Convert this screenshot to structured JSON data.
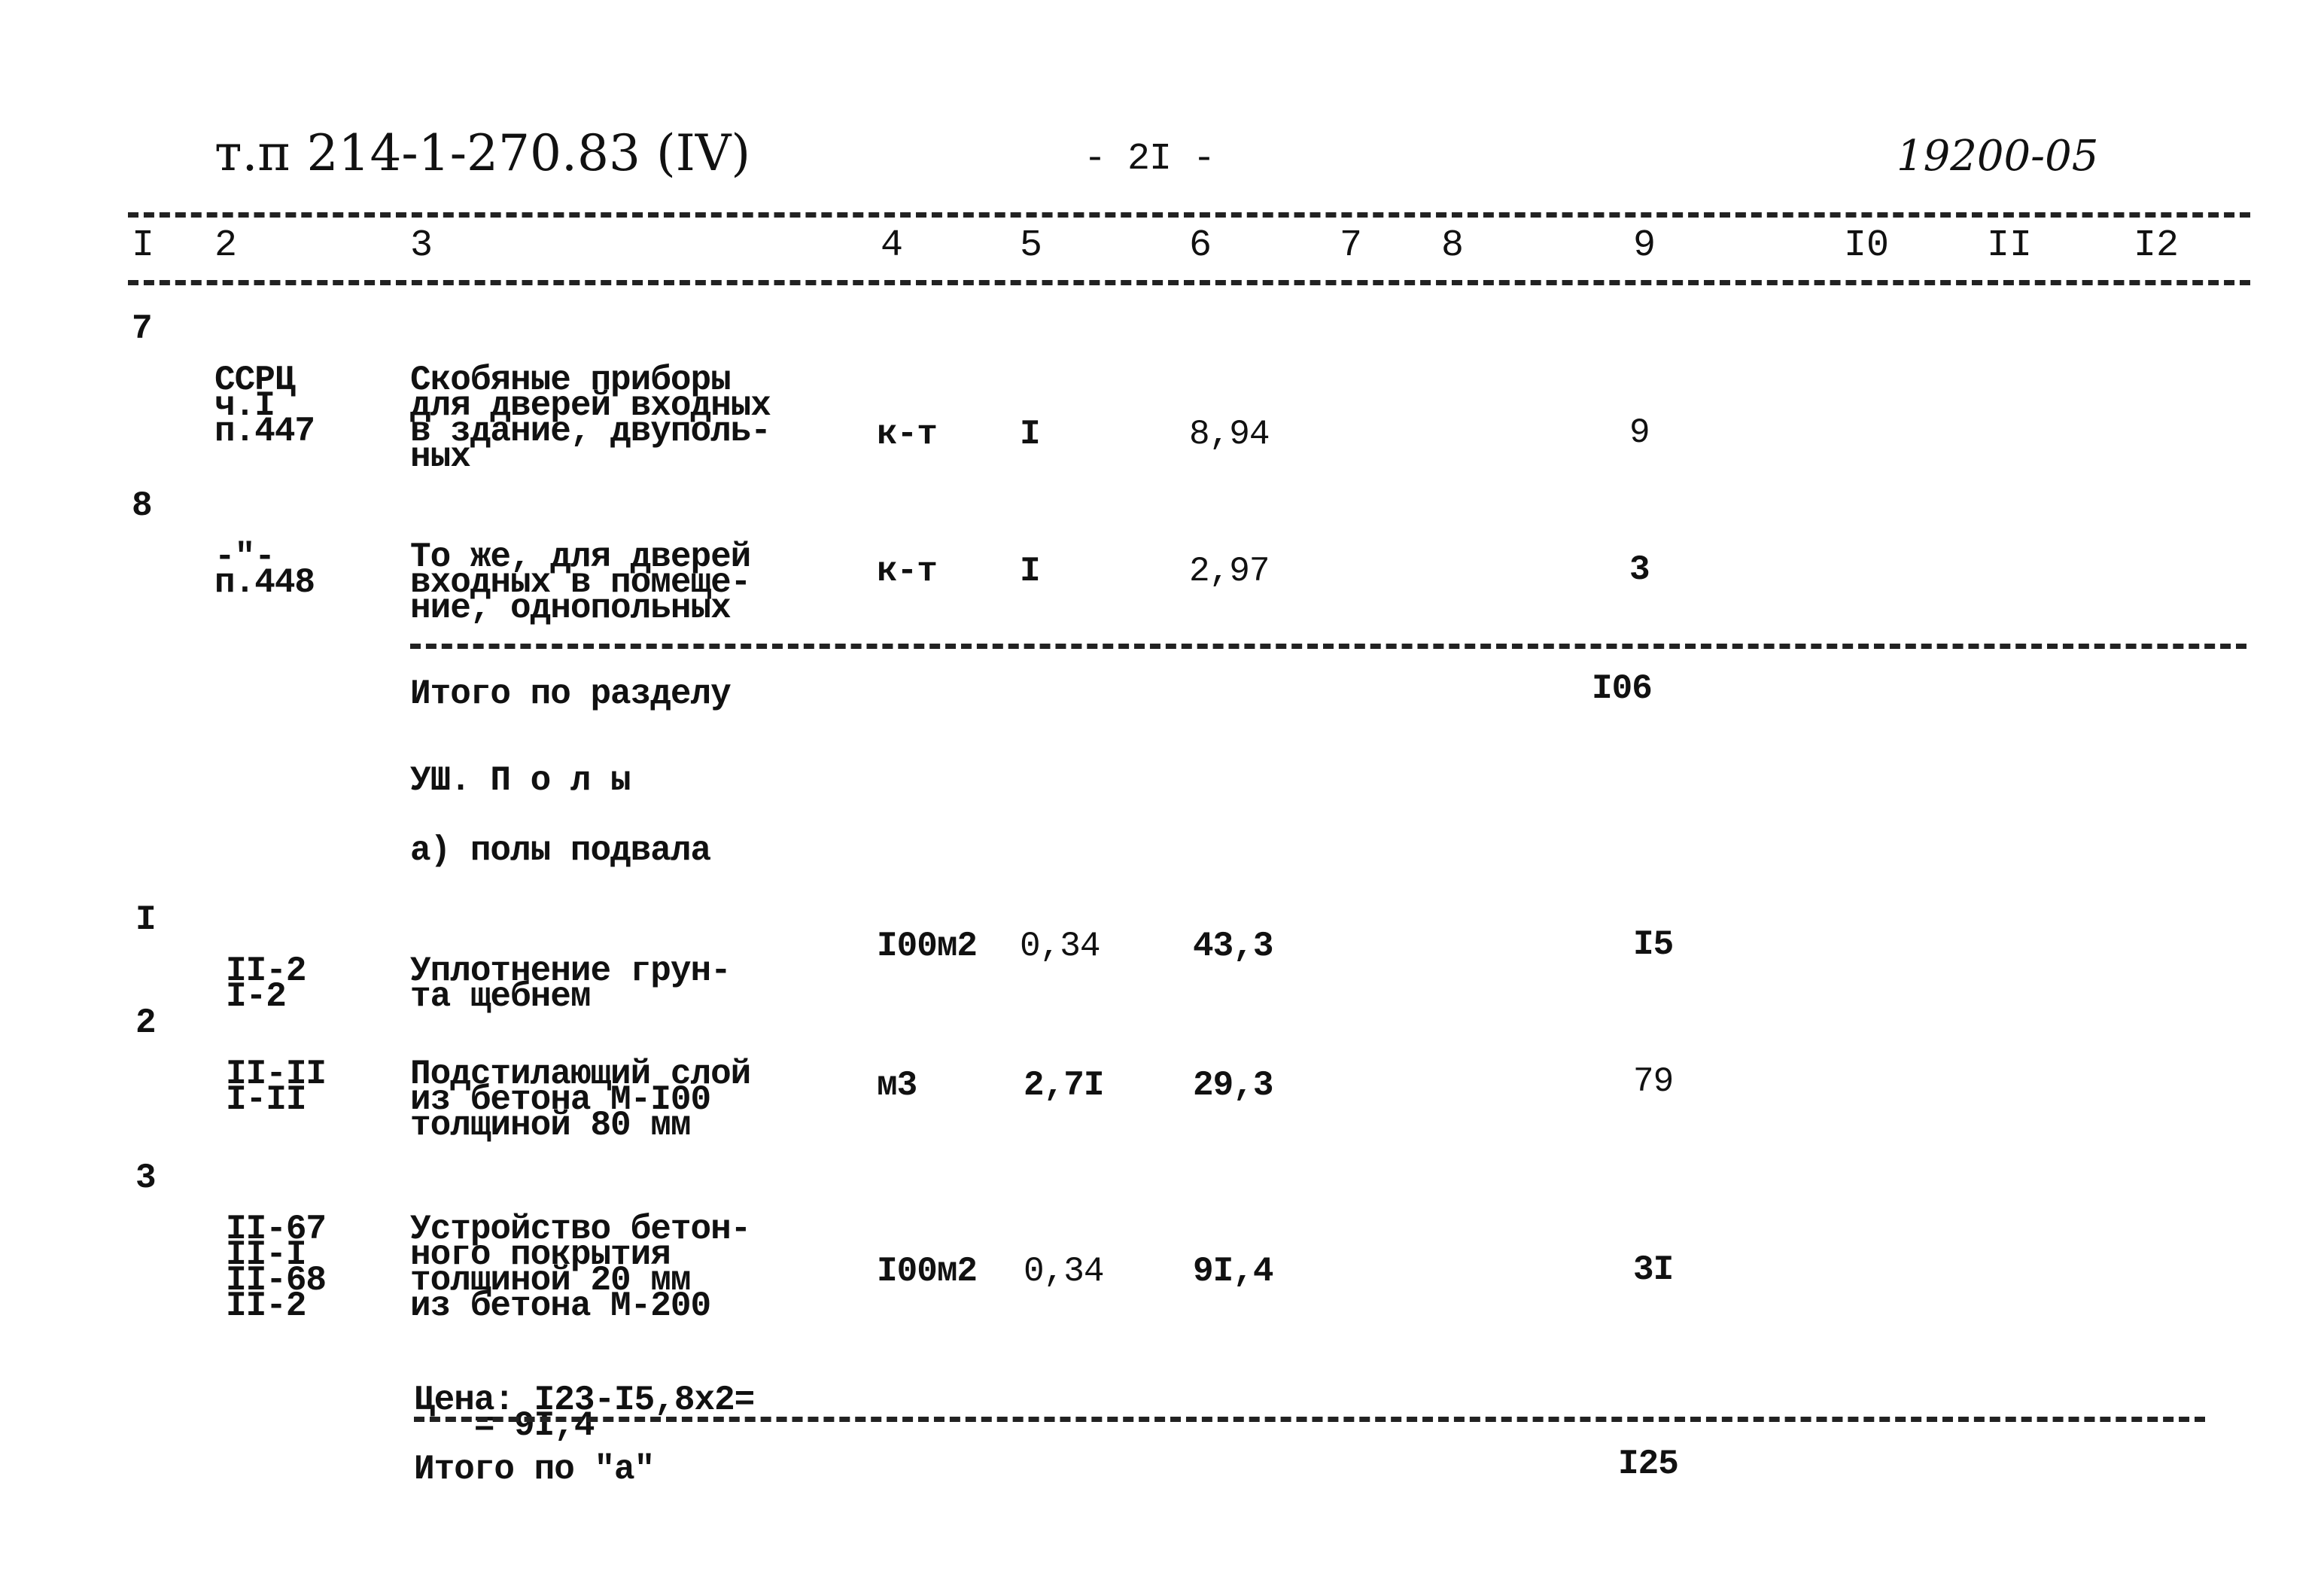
{
  "header": {
    "doc_code": "т.п 214-1-270.83 (IV)",
    "page_number": "- 2I -",
    "archive_number": "19200-05"
  },
  "columns": [
    "I",
    "2",
    "3",
    "4",
    "5",
    "6",
    "7",
    "8",
    "9",
    "I0",
    "II",
    "I2"
  ],
  "rows_part1": [
    {
      "num": "7",
      "code": [
        "ССРЦ",
        "ч.I",
        "п.447"
      ],
      "desc": [
        "Скобяные приборы",
        "для дверей входных",
        "в здание, двуполь-",
        "ных"
      ],
      "unit": "к-т",
      "qty": "I",
      "price": "8,94",
      "total": "9"
    },
    {
      "num": "8",
      "code": [
        "-\"-",
        "п.448"
      ],
      "desc": [
        "То же, для дверей",
        "входных в помеще-",
        "ние, однопольных"
      ],
      "unit": "к-т",
      "qty": "I",
      "price": "2,97",
      "total": "3"
    }
  ],
  "section_total": {
    "label": "Итого по разделу",
    "value": "I06"
  },
  "section_title": "УШ. П о л ы",
  "subsection_title": "а) полы подвала",
  "rows_part2": [
    {
      "num": "I",
      "code": [
        "II-2",
        "I-2"
      ],
      "desc": [
        "Уплотнение грун-",
        "та щебнем"
      ],
      "unit": "I00м2",
      "qty": "0,34",
      "price": "43,3",
      "total": "I5"
    },
    {
      "num": "2",
      "code": [
        "II-II",
        "I-II"
      ],
      "desc": [
        "Подстилающий слой",
        "из бетона М-I00",
        "толщиной 80 мм"
      ],
      "unit": "м3",
      "qty": "2,7I",
      "price": "29,3",
      "total": "79"
    },
    {
      "num": "3",
      "code": [
        "II-67",
        "II-I",
        "II-68",
        "II-2"
      ],
      "desc": [
        "Устройство бетон-",
        "ного покрытия",
        "толщиной 20 мм",
        "из бетона М-200"
      ],
      "unit": "I00м2",
      "qty": "0,34",
      "price": "9I,4",
      "total": "3I",
      "note": [
        "Цена: I23-I5,8х2=",
        "   = 9I,4"
      ]
    }
  ],
  "subtotal_a": {
    "label": "Итого по \"а\"",
    "value": "I25"
  }
}
